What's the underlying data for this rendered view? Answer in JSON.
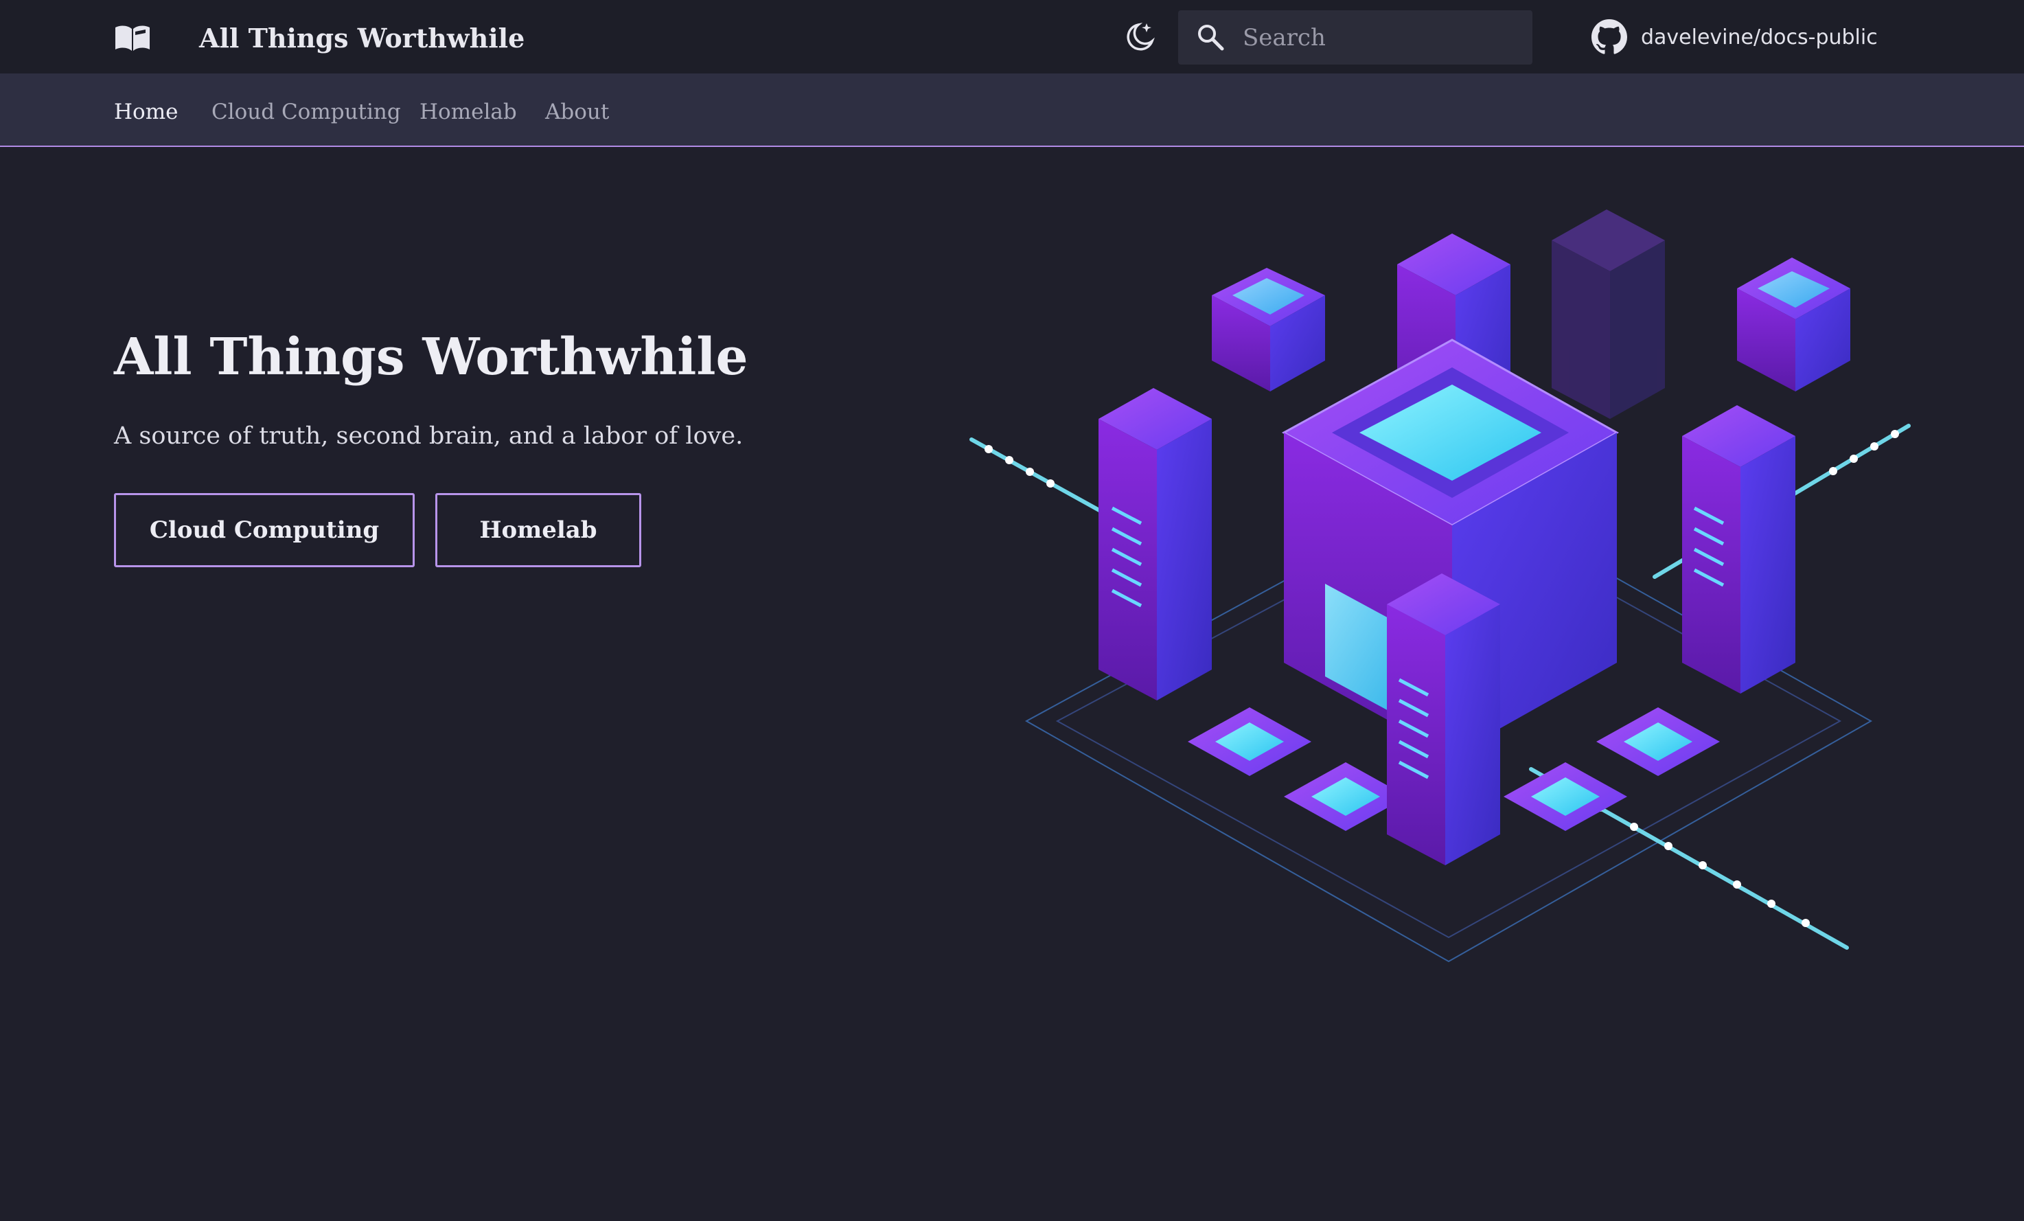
{
  "header": {
    "logo_icon": "open-book-icon",
    "title": "All Things Worthwhile",
    "theme_toggle_icon": "moon-stars-icon",
    "search": {
      "placeholder": "Search",
      "value": "",
      "icon": "search-icon"
    },
    "repo": {
      "icon": "github-icon",
      "label": "davelevine/docs-public"
    }
  },
  "tabs": [
    {
      "label": "Home",
      "active": true
    },
    {
      "label": "Cloud Computing",
      "active": false
    },
    {
      "label": "Homelab",
      "active": false
    },
    {
      "label": "About",
      "active": false
    }
  ],
  "hero": {
    "title": "All Things Worthwhile",
    "subtitle": "A source of truth, second brain, and a labor of love.",
    "buttons": [
      {
        "label": "Cloud Computing"
      },
      {
        "label": "Homelab"
      }
    ],
    "illustration": "isometric-server-datacenter-illustration"
  },
  "colors": {
    "background": "#1f1f2b",
    "header": "#1d1e28",
    "tabs_bar": "#2e2f42",
    "accent": "#b794ea",
    "illustration_purple": "#7b2ff0",
    "illustration_cyan": "#4de2ff"
  }
}
